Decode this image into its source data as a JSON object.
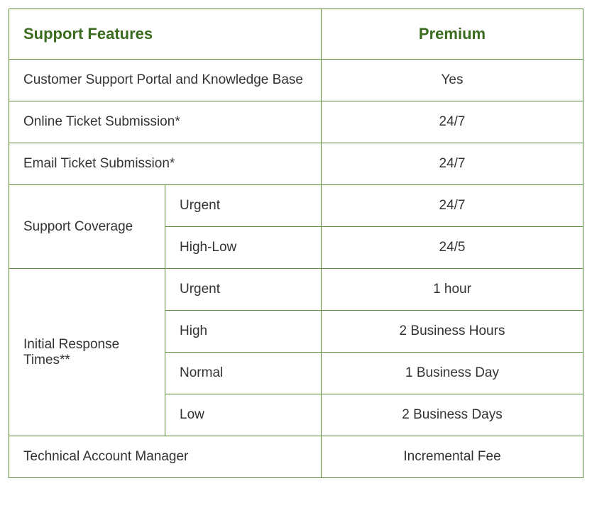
{
  "headers": {
    "features": "Support Features",
    "premium": "Premium"
  },
  "rows": {
    "portal": {
      "label": "Customer Support Portal and Knowledge Base",
      "value": "Yes"
    },
    "online_ticket": {
      "label": "Online Ticket Submission*",
      "value": "24/7"
    },
    "email_ticket": {
      "label": "Email Ticket Submission*",
      "value": "24/7"
    },
    "support_coverage": {
      "label": "Support Coverage",
      "urgent_label": "Urgent",
      "urgent_value": "24/7",
      "highlow_label": "High-Low",
      "highlow_value": "24/5"
    },
    "response_times": {
      "label": "Initial Response Times**",
      "urgent_label": "Urgent",
      "urgent_value": "1 hour",
      "high_label": "High",
      "high_value": "2 Business Hours",
      "normal_label": "Normal",
      "normal_value": "1 Business Day",
      "low_label": "Low",
      "low_value": "2 Business Days"
    },
    "tam": {
      "label": "Technical Account Manager",
      "value": "Incremental Fee"
    }
  }
}
